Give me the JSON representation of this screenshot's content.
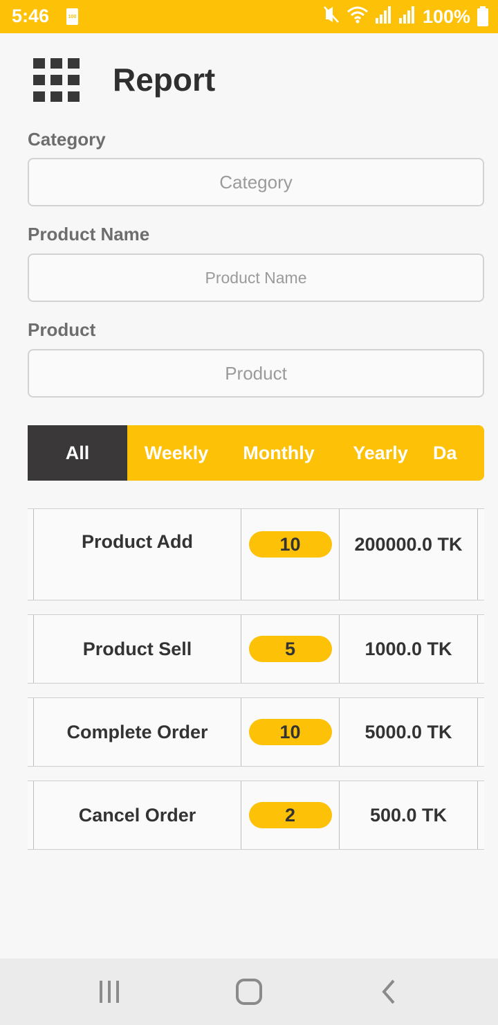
{
  "status_bar": {
    "time": "5:46",
    "battery_small_label": "100",
    "battery_percent": "100%",
    "icons": [
      "mute-vibrate-icon",
      "wifi-icon",
      "signal-icon",
      "signal-icon",
      "battery-icon"
    ]
  },
  "header": {
    "title": "Report",
    "menu_icon": "grid-menu-icon"
  },
  "form": {
    "category": {
      "label": "Category",
      "placeholder": "Category"
    },
    "product_name": {
      "label": "Product Name",
      "placeholder": "Product Name"
    },
    "product": {
      "label": "Product",
      "placeholder": "Product"
    }
  },
  "tabs": [
    {
      "label": "All",
      "active": true
    },
    {
      "label": "Weekly",
      "active": false
    },
    {
      "label": "Monthly",
      "active": false
    },
    {
      "label": "Yearly",
      "active": false
    },
    {
      "label": "Da",
      "active": false
    }
  ],
  "report_rows": [
    {
      "label": "Product Add",
      "count": "10",
      "amount": "200000.0 TK"
    },
    {
      "label": "Product Sell",
      "count": "5",
      "amount": "1000.0 TK"
    },
    {
      "label": "Complete Order",
      "count": "10",
      "amount": "5000.0 TK"
    },
    {
      "label": "Cancel Order",
      "count": "2",
      "amount": "500.0 TK"
    }
  ],
  "colors": {
    "accent": "#fdc108",
    "active_tab": "#3a3839",
    "text_dark": "#333333",
    "label_gray": "#6d6d6d"
  },
  "nav_bar": {
    "icons": [
      "recent-apps-icon",
      "home-icon",
      "back-icon"
    ]
  }
}
